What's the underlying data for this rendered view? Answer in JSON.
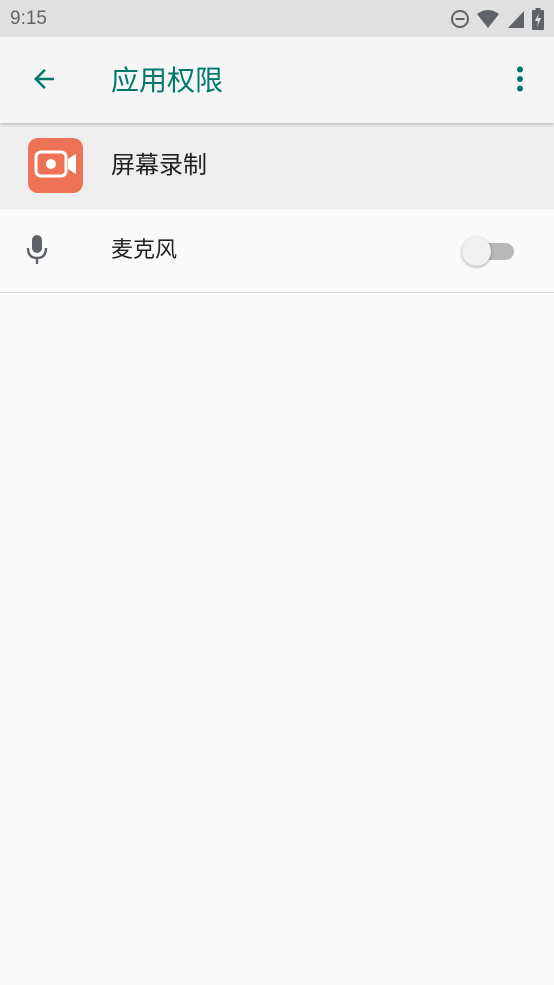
{
  "status_bar": {
    "time": "9:15",
    "icons": [
      "do-not-disturb-icon",
      "wifi-icon",
      "cell-signal-icon",
      "battery-charging-icon"
    ]
  },
  "app_bar": {
    "title": "应用权限",
    "back_icon": "arrow-left-icon",
    "overflow_icon": "more-vert-icon"
  },
  "app_header": {
    "name": "屏幕录制",
    "icon": "video-camera-icon",
    "icon_color": "#ee7356"
  },
  "permissions": [
    {
      "label": "麦克风",
      "icon": "microphone-icon",
      "enabled": false
    }
  ],
  "colors": {
    "accent": "#00796b",
    "app_icon_bg": "#ee7356",
    "toggle_track_off": "#b9b9b9",
    "toggle_thumb_off": "#f1f1f1"
  }
}
